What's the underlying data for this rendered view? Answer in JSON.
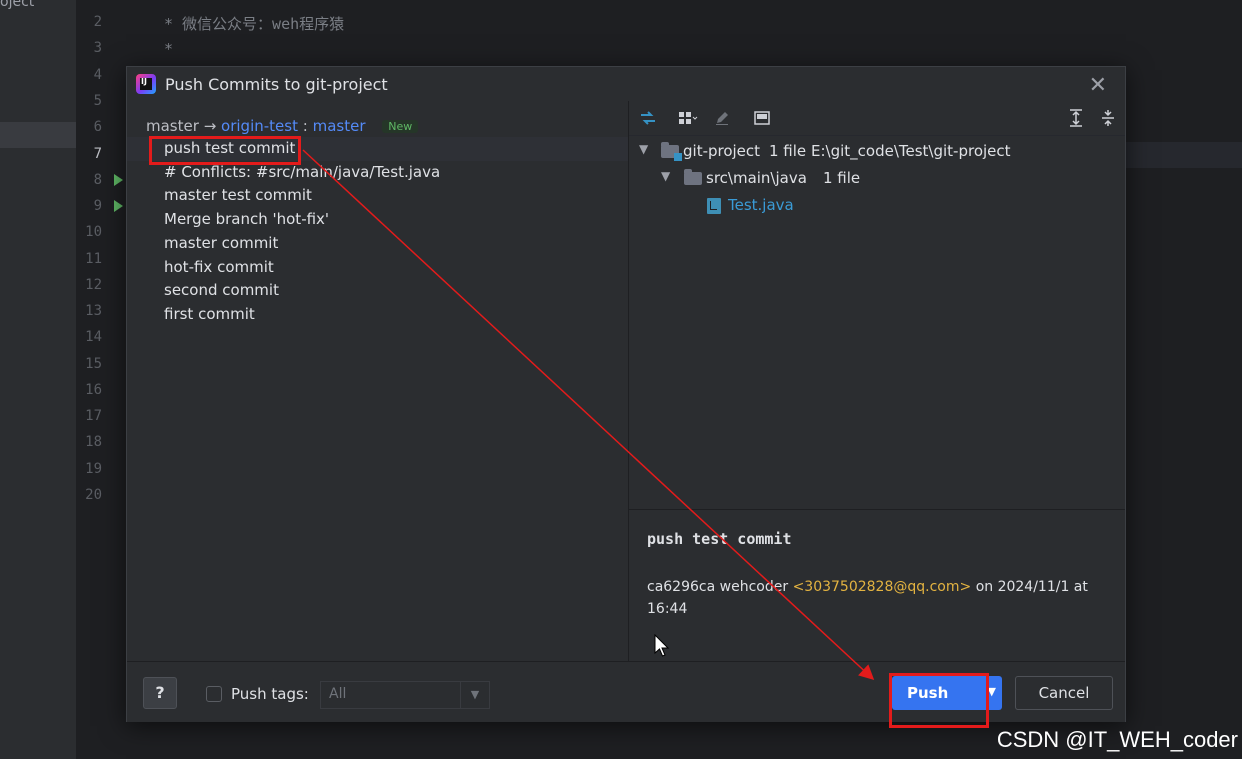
{
  "project_pane": {
    "label": "oject"
  },
  "editor": {
    "line_numbers": [
      "2",
      "3",
      "4",
      "5",
      "6",
      "7",
      "8",
      "9",
      "10",
      "11",
      "12",
      "13",
      "14",
      "15",
      "16",
      "17",
      "18",
      "19",
      "20"
    ],
    "current_line": "7",
    "code_lines": [
      "* 微信公众号：weh程序猿",
      "*"
    ]
  },
  "dialog": {
    "title": "Push Commits to git-project",
    "branch": {
      "local": "master",
      "arrow": "→",
      "remote": "origin-test",
      "separator": ":",
      "target": "master",
      "badge": "New"
    },
    "commits": [
      "push test commit",
      "# Conflicts: #src/main/java/Test.java",
      "master test commit",
      "Merge branch 'hot-fix'",
      "master commit",
      "hot-fix commit",
      "second commit",
      "first commit"
    ],
    "tree": {
      "root": {
        "name": "git-project",
        "count": "1 file",
        "path": "E:\\git_code\\Test\\git-project"
      },
      "folder": {
        "name": "src\\main\\java",
        "count": "1 file"
      },
      "file": {
        "name": "Test.java"
      }
    },
    "details": {
      "title": "push test commit",
      "hash": "ca6296ca",
      "author": "wehcoder",
      "email": "<3037502828@qq.com>",
      "date_text": "on 2024/11/1 at 16:44"
    },
    "footer": {
      "help_label": "?",
      "push_tags_label": "Push tags:",
      "tags_value": "All",
      "push_label": "Push",
      "cancel_label": "Cancel"
    }
  },
  "watermark": "CSDN @IT_WEH_coder",
  "colors": {
    "accent": "#3574f0",
    "link": "#548af7",
    "annotation": "#e31b1b",
    "email": "#e3b341"
  }
}
